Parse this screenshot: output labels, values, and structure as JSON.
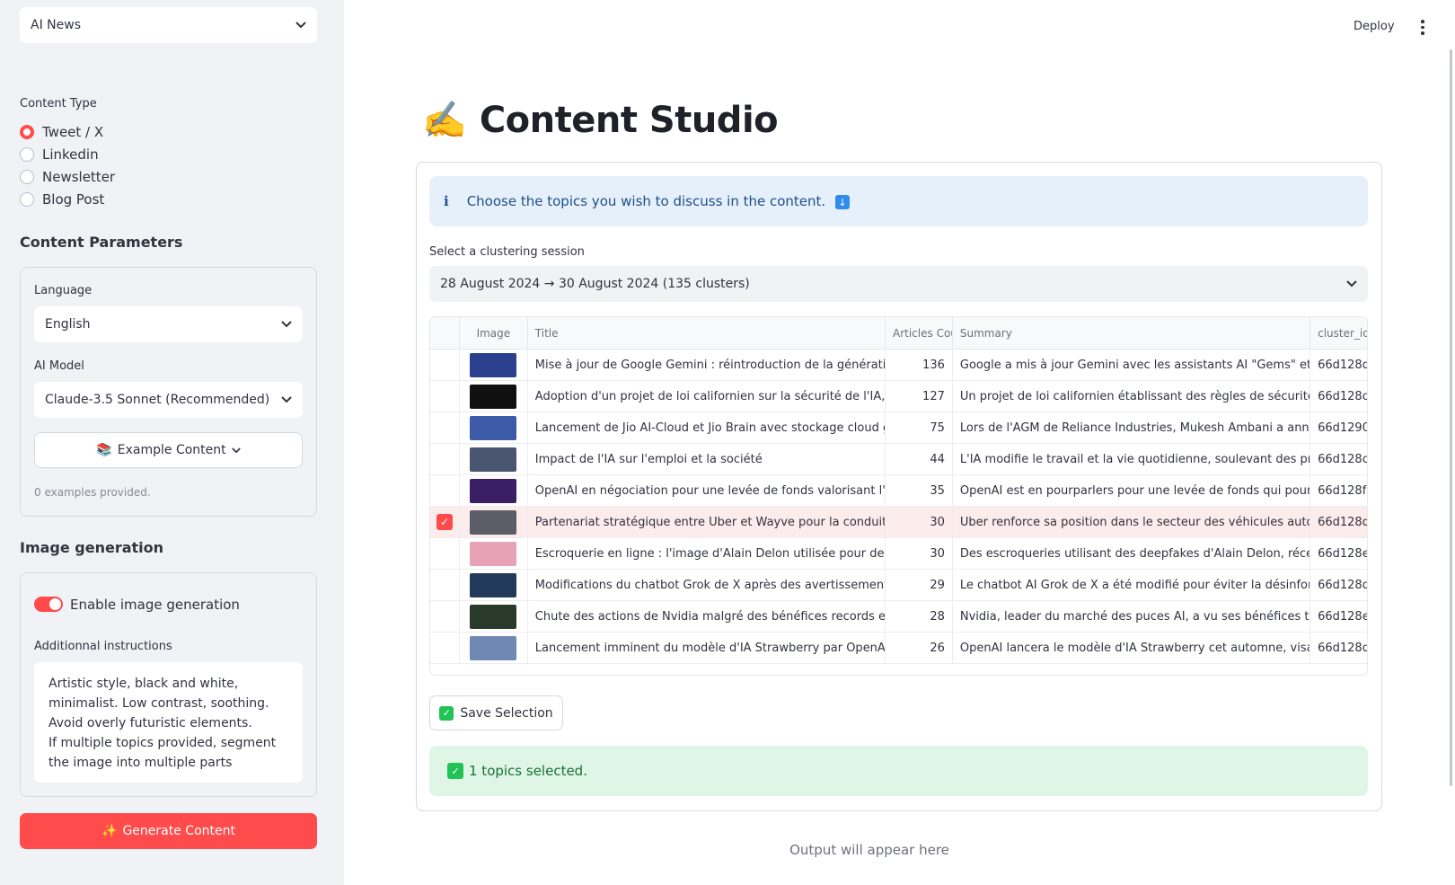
{
  "sidebar": {
    "app_select": "AI News",
    "content_type_label": "Content Type",
    "content_types": [
      {
        "label": "Tweet / X",
        "selected": true
      },
      {
        "label": "Linkedin",
        "selected": false
      },
      {
        "label": "Newsletter",
        "selected": false
      },
      {
        "label": "Blog Post",
        "selected": false
      }
    ],
    "params_heading": "Content Parameters",
    "language_label": "Language",
    "language_value": "English",
    "model_label": "AI Model",
    "model_value": "Claude-3.5 Sonnet (Recommended)",
    "example_button": "Example Content",
    "examples_note": "0 examples provided.",
    "image_heading": "Image generation",
    "enable_image_label": "Enable image generation",
    "enable_image_on": true,
    "instructions_label": "Additionnal instructions",
    "instructions_value": "Artistic style, black and white, minimalist. Low contrast, soothing. Avoid overly futuristic elements.\nIf multiple topics provided, segment the image into multiple parts",
    "generate_button": "Generate Content"
  },
  "header": {
    "deploy": "Deploy"
  },
  "main": {
    "title_emoji": "✍️",
    "title": "Content Studio",
    "info_text": "Choose the topics you wish to discuss in the content.",
    "session_label": "Select a clustering session",
    "session_value": "28 August 2024 → 30 August 2024 (135 clusters)",
    "table": {
      "columns": [
        "",
        "Image",
        "Title",
        "Articles Cou",
        "Summary",
        "cluster_id"
      ],
      "rows": [
        {
          "title": "Mise à jour de Google Gemini : réintroduction de la génération d'ima",
          "count": "136",
          "summary": "Google a mis à jour Gemini avec les assistants AI \"Gems\" et le modè",
          "cluster": "66d128d",
          "selected": false,
          "thumb": "#2b3f8f"
        },
        {
          "title": "Adoption d'un projet de loi californien sur la sécurité de l'IA, suscita",
          "count": "127",
          "summary": "Un projet de loi californien établissant des règles de sécurité pour l'",
          "cluster": "66d128c",
          "selected": false,
          "thumb": "#101010"
        },
        {
          "title": "Lancement de Jio AI-Cloud et Jio Brain avec stockage cloud gratuit",
          "count": "75",
          "summary": "Lors de l'AGM de Reliance Industries, Mukesh Ambani a annoncé plu",
          "cluster": "66d1290",
          "selected": false,
          "thumb": "#3c5aa8"
        },
        {
          "title": "Impact de l'IA sur l'emploi et la société",
          "count": "44",
          "summary": "L'IA modifie le travail et la vie quotidienne, soulevant des préoccupa",
          "cluster": "66d128c",
          "selected": false,
          "thumb": "#4a5670"
        },
        {
          "title": "OpenAI en négociation pour une levée de fonds valorisant l'entrepri",
          "count": "35",
          "summary": "OpenAI est en pourparlers pour une levée de fonds qui pourrait valo",
          "cluster": "66d128f",
          "selected": false,
          "thumb": "#3a1f66"
        },
        {
          "title": "Partenariat stratégique entre Uber et Wayve pour la conduite auton",
          "count": "30",
          "summary": "Uber renforce sa position dans le secteur des véhicules autonomes",
          "cluster": "66d128d",
          "selected": true,
          "thumb": "#5b5e66"
        },
        {
          "title": "Escroquerie en ligne : l'image d'Alain Delon utilisée pour des arnaqu",
          "count": "30",
          "summary": "Des escroqueries utilisant des deepfakes d'Alain Delon, récemment",
          "cluster": "66d128e",
          "selected": false,
          "thumb": "#e8a2b8"
        },
        {
          "title": "Modifications du chatbot Grok de X après des avertissements sur la",
          "count": "29",
          "summary": "Le chatbot AI Grok de X a été modifié pour éviter la désinformation",
          "cluster": "66d128d",
          "selected": false,
          "thumb": "#22395c"
        },
        {
          "title": "Chute des actions de Nvidia malgré des bénéfices records et une for",
          "count": "28",
          "summary": "Nvidia, leader du marché des puces AI, a vu ses bénéfices trimestrie",
          "cluster": "66d128e",
          "selected": false,
          "thumb": "#2a3a2a"
        },
        {
          "title": "Lancement imminent du modèle d'IA Strawberry par OpenAI cet au",
          "count": "26",
          "summary": "OpenAI lancera le modèle d'IA Strawberry cet automne, visant à am",
          "cluster": "66d128d",
          "selected": false,
          "thumb": "#6f88b4"
        }
      ]
    },
    "save_button": "Save Selection",
    "success_text": "1 topics selected.",
    "output_placeholder": "Output will appear here"
  },
  "colors": {
    "accent": "#ff4b4b",
    "sidebar_bg": "#f0f2f6",
    "info_bg": "#e6f0fa",
    "success_bg": "#dff5e6"
  }
}
